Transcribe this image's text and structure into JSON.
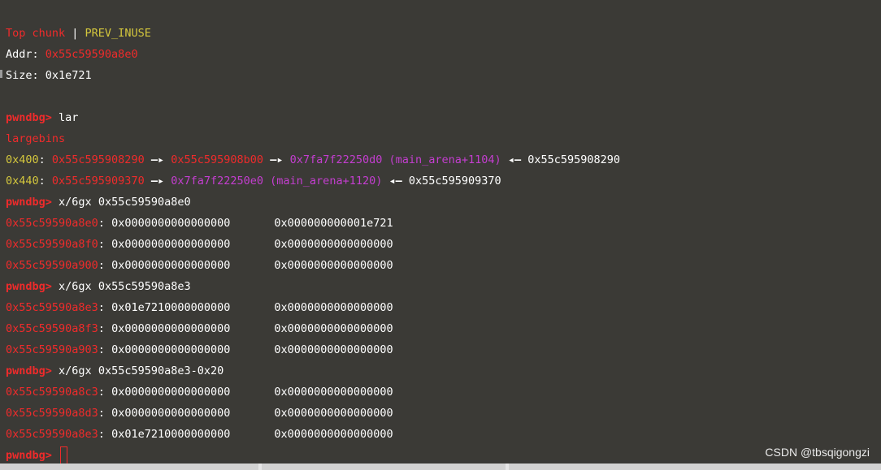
{
  "chunk": {
    "title": "Top chunk",
    "sep": " | ",
    "flag": "PREV_INUSE",
    "addr_label": "Addr: ",
    "addr_value": "0x55c59590a8e0",
    "size_label": "Size: ",
    "size_value": "0x1e721"
  },
  "prompt": "pwndbg>",
  "commands": {
    "c1": "lar",
    "c2": "x/6gx 0x55c59590a8e0",
    "c3": "x/6gx 0x55c59590a8e3",
    "c4": "x/6gx 0x55c59590a8e3-0x20"
  },
  "largebins": {
    "header": "largebins",
    "bin1": {
      "size": "0x400",
      "a": "0x55c595908290",
      "b": "0x55c595908b00",
      "c": "0x7fa7f22250d0 (main_arena+1104)",
      "back": "0x55c595908290"
    },
    "bin2": {
      "size": "0x440",
      "a": "0x55c595909370",
      "c": "0x7fa7f22250e0 (main_arena+1120)",
      "back": "0x55c595909370"
    },
    "fwd_arrow": "—▸",
    "back_arrow": "◂—"
  },
  "dumps": {
    "d1": [
      {
        "addr": "0x55c59590a8e0",
        "v1": "0x0000000000000000",
        "v2": "0x000000000001e721"
      },
      {
        "addr": "0x55c59590a8f0",
        "v1": "0x0000000000000000",
        "v2": "0x0000000000000000"
      },
      {
        "addr": "0x55c59590a900",
        "v1": "0x0000000000000000",
        "v2": "0x0000000000000000"
      }
    ],
    "d2": [
      {
        "addr": "0x55c59590a8e3",
        "v1": "0x01e7210000000000",
        "v2": "0x0000000000000000"
      },
      {
        "addr": "0x55c59590a8f3",
        "v1": "0x0000000000000000",
        "v2": "0x0000000000000000"
      },
      {
        "addr": "0x55c59590a903",
        "v1": "0x0000000000000000",
        "v2": "0x0000000000000000"
      }
    ],
    "d3": [
      {
        "addr": "0x55c59590a8c3",
        "v1": "0x0000000000000000",
        "v2": "0x0000000000000000"
      },
      {
        "addr": "0x55c59590a8d3",
        "v1": "0x0000000000000000",
        "v2": "0x0000000000000000"
      },
      {
        "addr": "0x55c59590a8e3",
        "v1": "0x01e7210000000000",
        "v2": "0x0000000000000000"
      }
    ]
  },
  "watermark": "CSDN @tbsqigongzi",
  "colors": {
    "background": "#3b3a36",
    "red": "#ef2b2b",
    "yellow": "#d4c73d",
    "magenta": "#c43ed0"
  }
}
